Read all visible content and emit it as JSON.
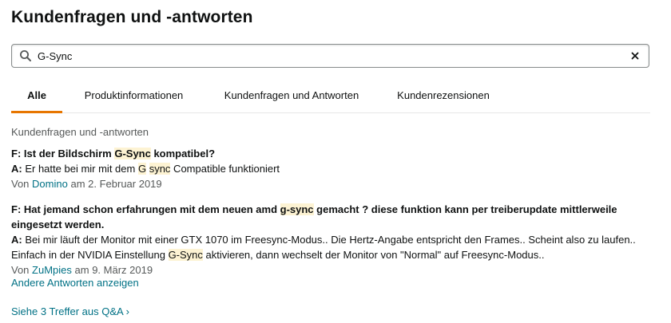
{
  "header": {
    "title": "Kundenfragen und -antworten"
  },
  "search": {
    "value": "G-Sync",
    "icon": "search-icon",
    "clear_icon": "close-icon"
  },
  "tabs": [
    {
      "label": "Alle",
      "active": true
    },
    {
      "label": "Produktinformationen",
      "active": false
    },
    {
      "label": "Kundenfragen und Antworten",
      "active": false
    },
    {
      "label": "Kundenrezensionen",
      "active": false
    }
  ],
  "section": {
    "label": "Kundenfragen und -antworten"
  },
  "results": [
    {
      "question_prefix": "F:",
      "question_parts": [
        "Ist der Bildschirm ",
        "G-Sync",
        " kompatibel?"
      ],
      "answer_prefix": "A:",
      "answer_parts": [
        "Er hatte bei mir mit dem ",
        "G",
        " ",
        "sync",
        " Compatible funktioniert"
      ],
      "by_prefix": "Von",
      "author": "Domino",
      "date": "am 2. Februar 2019"
    },
    {
      "question_prefix": "F:",
      "question_parts": [
        "Hat jemand schon erfahrungen mit dem neuen amd ",
        "g-sync",
        " gemacht ? diese funktion kann per treiberupdate mittlerweile eingesetzt werden."
      ],
      "answer_prefix": "A:",
      "answer_parts": [
        "Bei mir läuft der Monitor mit einer GTX 1070 im Freesync-Modus.. Die Hertz-Angabe entspricht den Frames.. Scheint also zu laufen.. Einfach in der NVIDIA Einstellung ",
        "G-Sync",
        " aktivieren, dann wechselt der Monitor von \"Normal\" auf Freesync-Modus.."
      ],
      "by_prefix": "Von",
      "author": "ZuMpies",
      "date": "am 9. März 2019"
    }
  ],
  "more_answers": "Andere Antworten anzeigen",
  "footer": {
    "link": "Siehe 3 Treffer aus Q&A ›"
  },
  "colors": {
    "accent": "#e77600",
    "link": "#007185",
    "highlight": "#fdf3d3",
    "muted": "#565959"
  }
}
